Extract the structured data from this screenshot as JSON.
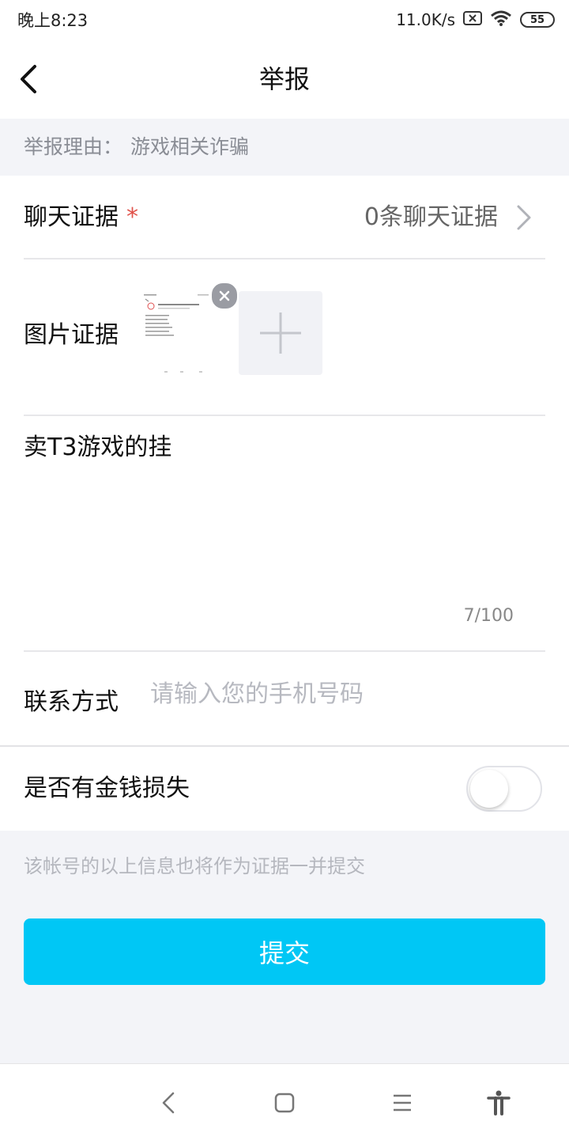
{
  "status_bar": {
    "time": "晚上8:23",
    "network_speed": "11.0K/s",
    "battery": "55"
  },
  "header": {
    "title": "举报"
  },
  "reason": {
    "label": "举报理由：",
    "value": "游戏相关诈骗"
  },
  "chat_evidence": {
    "label": "聊天证据",
    "required_mark": "*",
    "count_text": "0条聊天证据"
  },
  "image_evidence": {
    "label": "图片证据"
  },
  "description": {
    "value": "卖T3游戏的挂",
    "counter": "7/100"
  },
  "contact": {
    "label": "联系方式",
    "placeholder": "请输入您的手机号码"
  },
  "money_loss": {
    "label": "是否有金钱损失",
    "enabled": false
  },
  "hint": "该帐号的以上信息也将作为证据一并提交",
  "submit_label": "提交",
  "colors": {
    "accent": "#00c7f5",
    "required": "#e0524a"
  }
}
